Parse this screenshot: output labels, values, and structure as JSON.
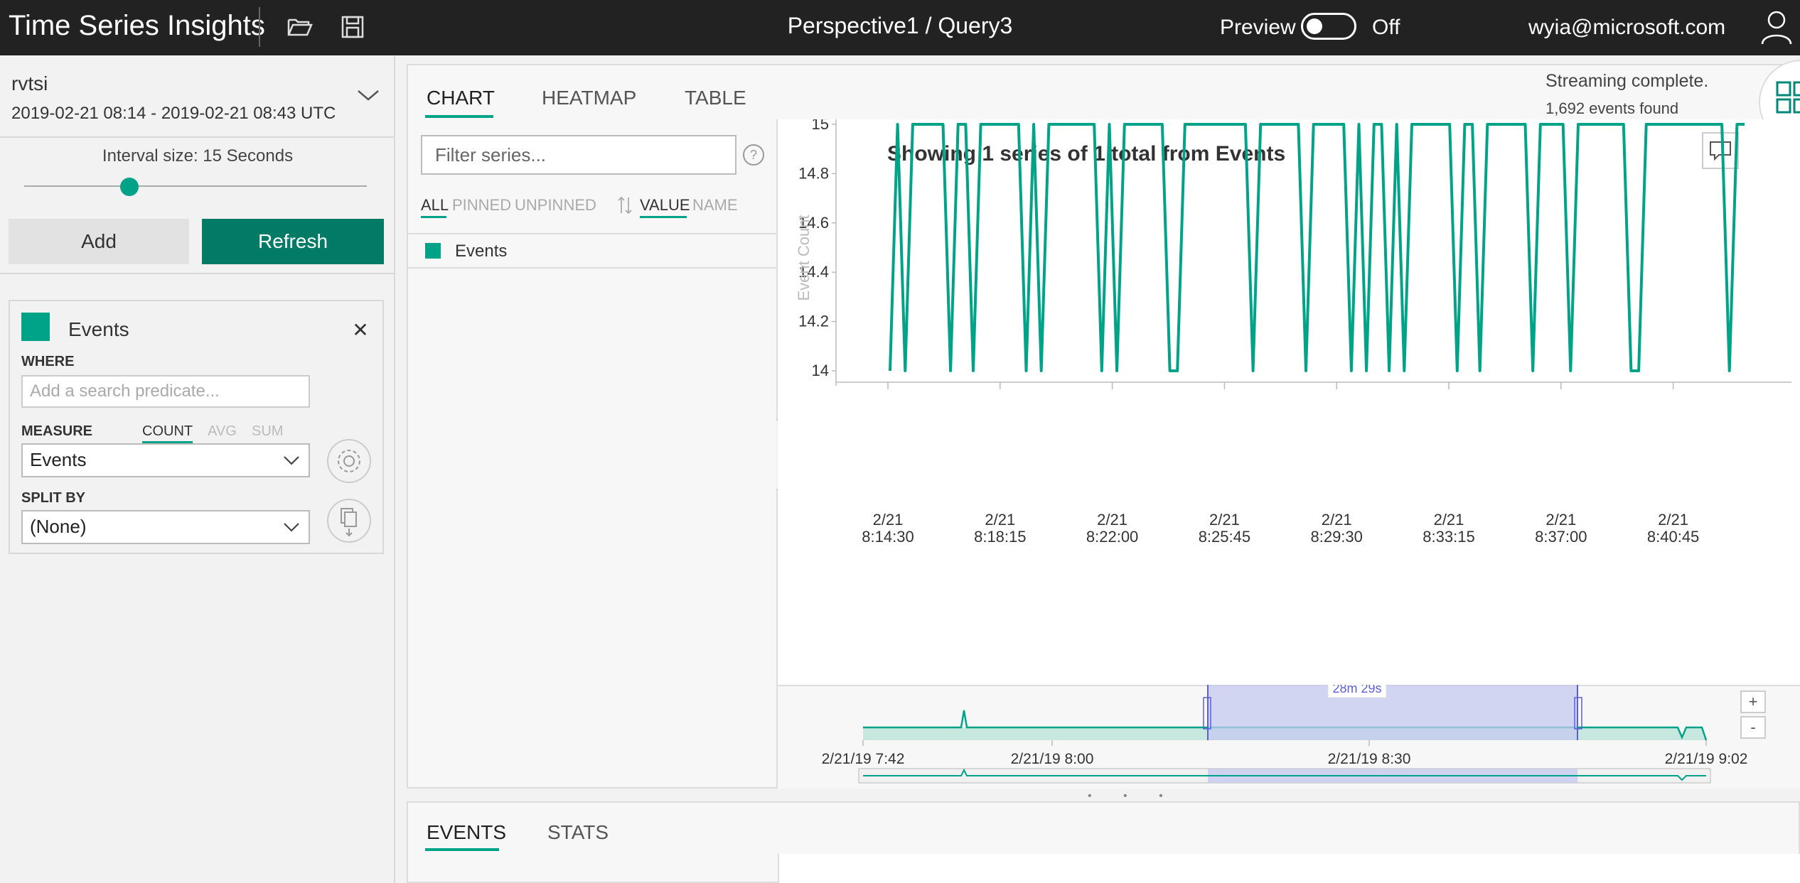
{
  "topbar": {
    "app_title": "Time Series Insights",
    "query_title": "Perspective1 / Query3",
    "preview_label": "Preview",
    "preview_state": "Off",
    "user_email": "wyia@microsoft.com"
  },
  "environment": {
    "name": "rvtsi",
    "range": "2019-02-21 08:14  -  2019-02-21 08:43 UTC"
  },
  "interval": {
    "label": "Interval size: 15 Seconds"
  },
  "actions": {
    "add_label": "Add",
    "refresh_label": "Refresh"
  },
  "event_card": {
    "name": "Events",
    "close_glyph": "✕",
    "where_label": "WHERE",
    "where_placeholder": "Add a search predicate...",
    "measure_label": "MEASURE",
    "measure_options": [
      "COUNT",
      "AVG",
      "SUM"
    ],
    "measure_value": "Events",
    "splitby_label": "SPLIT BY",
    "splitby_value": "(None)"
  },
  "main_tabs": [
    "CHART",
    "HEATMAP",
    "TABLE"
  ],
  "status": {
    "streaming": "Streaming complete.",
    "events_found": "1,692 events found"
  },
  "series_panel": {
    "filter_placeholder": "Filter series...",
    "filters": [
      "ALL",
      "PINNED",
      "UNPINNED"
    ],
    "sorts": [
      "VALUE",
      "NAME"
    ],
    "series": [
      "Events"
    ]
  },
  "chart_data": {
    "type": "line",
    "title": "Showing 1 series of 1 total from Events",
    "ylabel": "Event Count",
    "ylim": [
      14,
      15
    ],
    "yticks": [
      "14",
      "14.2",
      "14.4",
      "14.6",
      "14.8",
      "15"
    ],
    "xticks": [
      [
        "2/21",
        "8:14:30"
      ],
      [
        "2/21",
        "8:18:15"
      ],
      [
        "2/21",
        "8:22:00"
      ],
      [
        "2/21",
        "8:25:45"
      ],
      [
        "2/21",
        "8:29:30"
      ],
      [
        "2/21",
        "8:33:15"
      ],
      [
        "2/21",
        "8:37:00"
      ],
      [
        "2/21",
        "8:40:45"
      ]
    ],
    "xrange": [
      "8:14:30",
      "8:43:00"
    ],
    "series": [
      {
        "name": "Events",
        "color": "#00a388",
        "values": [
          14,
          15,
          14,
          15,
          15,
          15,
          15,
          15,
          14,
          15,
          15,
          14,
          15,
          15,
          15,
          15,
          15,
          15,
          14,
          15,
          14,
          15,
          15,
          15,
          15,
          15,
          15,
          15,
          14,
          15,
          14,
          15,
          15,
          15,
          15,
          15,
          15,
          14,
          14,
          15,
          15,
          15,
          15,
          15,
          15,
          15,
          15,
          15,
          14,
          15,
          15,
          15,
          15,
          15,
          15,
          14,
          15,
          15,
          15,
          15,
          15,
          14,
          15,
          14,
          15,
          15,
          14,
          15,
          14,
          15,
          15,
          15,
          15,
          15,
          15,
          14,
          15,
          15,
          14,
          15,
          15,
          15,
          15,
          15,
          15,
          14,
          15,
          15,
          15,
          15,
          14,
          15,
          15,
          15,
          15,
          15,
          15,
          15,
          14,
          14,
          15,
          15,
          15,
          15,
          15,
          15,
          15,
          15,
          15,
          15,
          15,
          14,
          15,
          15
        ]
      }
    ]
  },
  "brush": {
    "selection_label": "28m 29s",
    "ticks": [
      "2/21/19 7:42",
      "2/21/19 8:00",
      "2/21/19 8:30",
      "2/21/19 9:02"
    ],
    "zoom_in": "+",
    "zoom_out": "-",
    "fill_color": "#c6e8df",
    "selection_color": "#c5c9f0"
  },
  "bottom_tabs": [
    "EVENTS",
    "STATS"
  ]
}
